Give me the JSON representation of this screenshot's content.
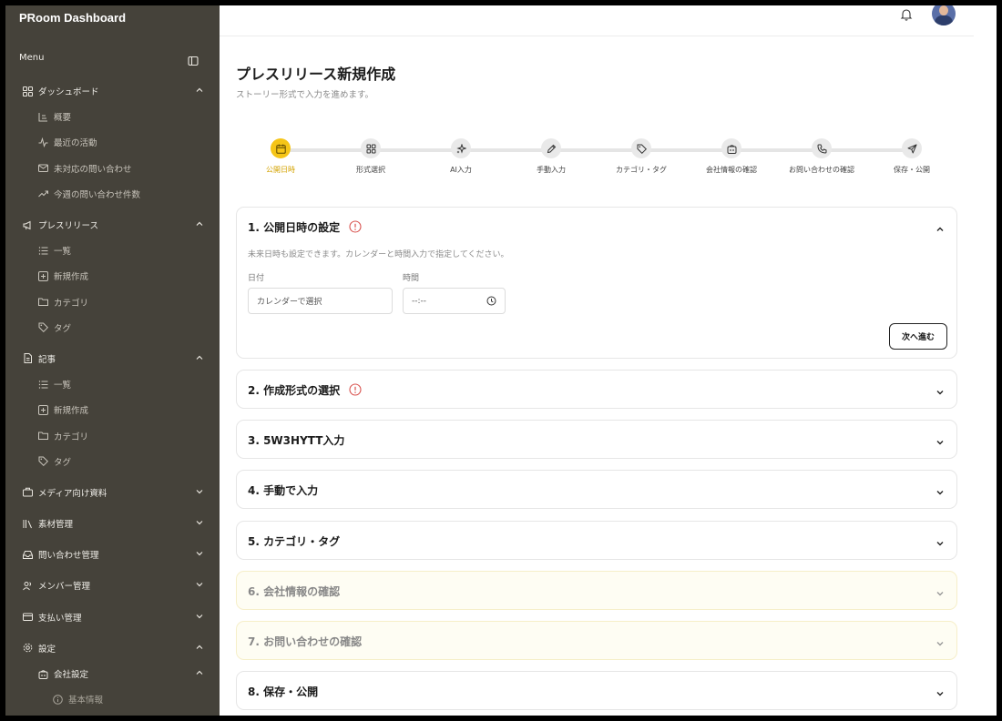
{
  "app": {
    "title": "PRoom Dashboard"
  },
  "sidebar": {
    "menu_label": "Menu",
    "groups": [
      {
        "label": "ダッシュボード",
        "icon": "grid-icon",
        "expanded": true,
        "items": [
          {
            "label": "概要",
            "icon": "chart-icon"
          },
          {
            "label": "最近の活動",
            "icon": "activity-icon"
          },
          {
            "label": "未対応の問い合わせ",
            "icon": "mail-icon"
          },
          {
            "label": "今週の問い合わせ件数",
            "icon": "trending-icon"
          }
        ]
      },
      {
        "label": "プレスリリース",
        "icon": "megaphone-icon",
        "expanded": true,
        "items": [
          {
            "label": "一覧",
            "icon": "list-icon"
          },
          {
            "label": "新規作成",
            "icon": "plus-square-icon"
          },
          {
            "label": "カテゴリ",
            "icon": "folder-icon"
          },
          {
            "label": "タグ",
            "icon": "tag-icon"
          }
        ]
      },
      {
        "label": "記事",
        "icon": "file-icon",
        "expanded": true,
        "items": [
          {
            "label": "一覧",
            "icon": "list-icon"
          },
          {
            "label": "新規作成",
            "icon": "plus-square-icon"
          },
          {
            "label": "カテゴリ",
            "icon": "folder-icon"
          },
          {
            "label": "タグ",
            "icon": "tag-icon"
          }
        ]
      },
      {
        "label": "メディア向け資料",
        "icon": "briefcase-icon",
        "expanded": false
      },
      {
        "label": "素材管理",
        "icon": "library-icon",
        "expanded": false
      },
      {
        "label": "問い合わせ管理",
        "icon": "inbox-icon",
        "expanded": false
      },
      {
        "label": "メンバー管理",
        "icon": "users-icon",
        "expanded": false
      },
      {
        "label": "支払い管理",
        "icon": "credit-card-icon",
        "expanded": false
      },
      {
        "label": "設定",
        "icon": "settings-icon",
        "expanded": true
      }
    ],
    "settings_sub": {
      "label": "会社設定",
      "icon": "building-icon"
    },
    "settings_sub2": {
      "label": "基本情報",
      "icon": "info-icon"
    }
  },
  "page": {
    "title": "プレスリリース新規作成",
    "subtitle": "ストーリー形式で入力を進めます。"
  },
  "steps": [
    {
      "label": "公開日時",
      "icon": "calendar-icon",
      "active": true
    },
    {
      "label": "形式選択",
      "icon": "grid-icon",
      "active": false
    },
    {
      "label": "AI入力",
      "icon": "sparkles-icon",
      "active": false
    },
    {
      "label": "手動入力",
      "icon": "pencil-icon",
      "active": false
    },
    {
      "label": "カテゴリ・タグ",
      "icon": "tag-icon",
      "active": false
    },
    {
      "label": "会社情報の確認",
      "icon": "building-icon",
      "active": false
    },
    {
      "label": "お問い合わせの確認",
      "icon": "phone-icon",
      "active": false
    },
    {
      "label": "保存・公開",
      "icon": "send-icon",
      "active": false
    }
  ],
  "sections": [
    {
      "title": "1. 公開日時の設定",
      "warning": true,
      "expanded": true,
      "pending": false
    },
    {
      "title": "2. 作成形式の選択",
      "warning": true,
      "expanded": false,
      "pending": false
    },
    {
      "title": "3. 5W3HYTT入力",
      "warning": false,
      "expanded": false,
      "pending": false
    },
    {
      "title": "4. 手動で入力",
      "warning": false,
      "expanded": false,
      "pending": false
    },
    {
      "title": "5. カテゴリ・タグ",
      "warning": false,
      "expanded": false,
      "pending": false
    },
    {
      "title": "6. 会社情報の確認",
      "warning": false,
      "expanded": false,
      "pending": true
    },
    {
      "title": "7. お問い合わせの確認",
      "warning": false,
      "expanded": false,
      "pending": true
    },
    {
      "title": "8. 保存・公開",
      "warning": false,
      "expanded": false,
      "pending": false
    }
  ],
  "schedule_form": {
    "description": "未来日時も設定できます。カレンダーと時間入力で指定してください。",
    "date_label": "日付",
    "date_placeholder": "カレンダーで選択",
    "time_label": "時間",
    "time_value": "--:--",
    "next_button": "次へ進む"
  },
  "colors": {
    "sidebar_bg": "#45423a",
    "accent": "#f5c518",
    "warning": "#d9534f",
    "pending_bg": "#fefdf3"
  }
}
